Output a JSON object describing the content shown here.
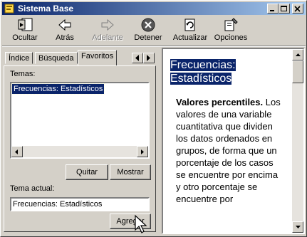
{
  "window": {
    "title": "Sistema Base"
  },
  "toolbar": {
    "buttons": [
      {
        "label": "Ocultar",
        "icon": "hide-pane-icon",
        "enabled": true
      },
      {
        "label": "Atrás",
        "icon": "back-arrow-icon",
        "enabled": true
      },
      {
        "label": "Adelante",
        "icon": "forward-arrow-icon",
        "enabled": false
      },
      {
        "label": "Detener",
        "icon": "stop-icon",
        "enabled": true
      },
      {
        "label": "Actualizar",
        "icon": "refresh-icon",
        "enabled": true
      },
      {
        "label": "Opciones",
        "icon": "options-icon",
        "enabled": true
      }
    ]
  },
  "tabs": [
    {
      "label": "Índice",
      "active": false
    },
    {
      "label": "Búsqueda",
      "active": false
    },
    {
      "label": "Favoritos",
      "active": true
    }
  ],
  "favorites": {
    "topics_label": "Temas:",
    "topics": [
      {
        "label": "Frecuencias: Estadísticos",
        "selected": true
      }
    ],
    "remove_button": "Quitar",
    "show_button": "Mostrar",
    "current_topic_label": "Tema actual:",
    "current_topic_value": "Frecuencias: Estadísticos",
    "add_button": "Agregar"
  },
  "content": {
    "title": "Frecuencias: Estadísticos",
    "term": "Valores percentiles.",
    "body": "Los valores de una variable cuantitativa que dividen los datos ordenados en grupos, de forma que un porcentaje de los casos se encuentre por encima y otro porcentaje se encuentre por"
  },
  "colors": {
    "title_bar_start": "#0a246a",
    "title_bar_end": "#a6caf0",
    "selection": "#0a246a",
    "face": "#d4d0c8"
  }
}
